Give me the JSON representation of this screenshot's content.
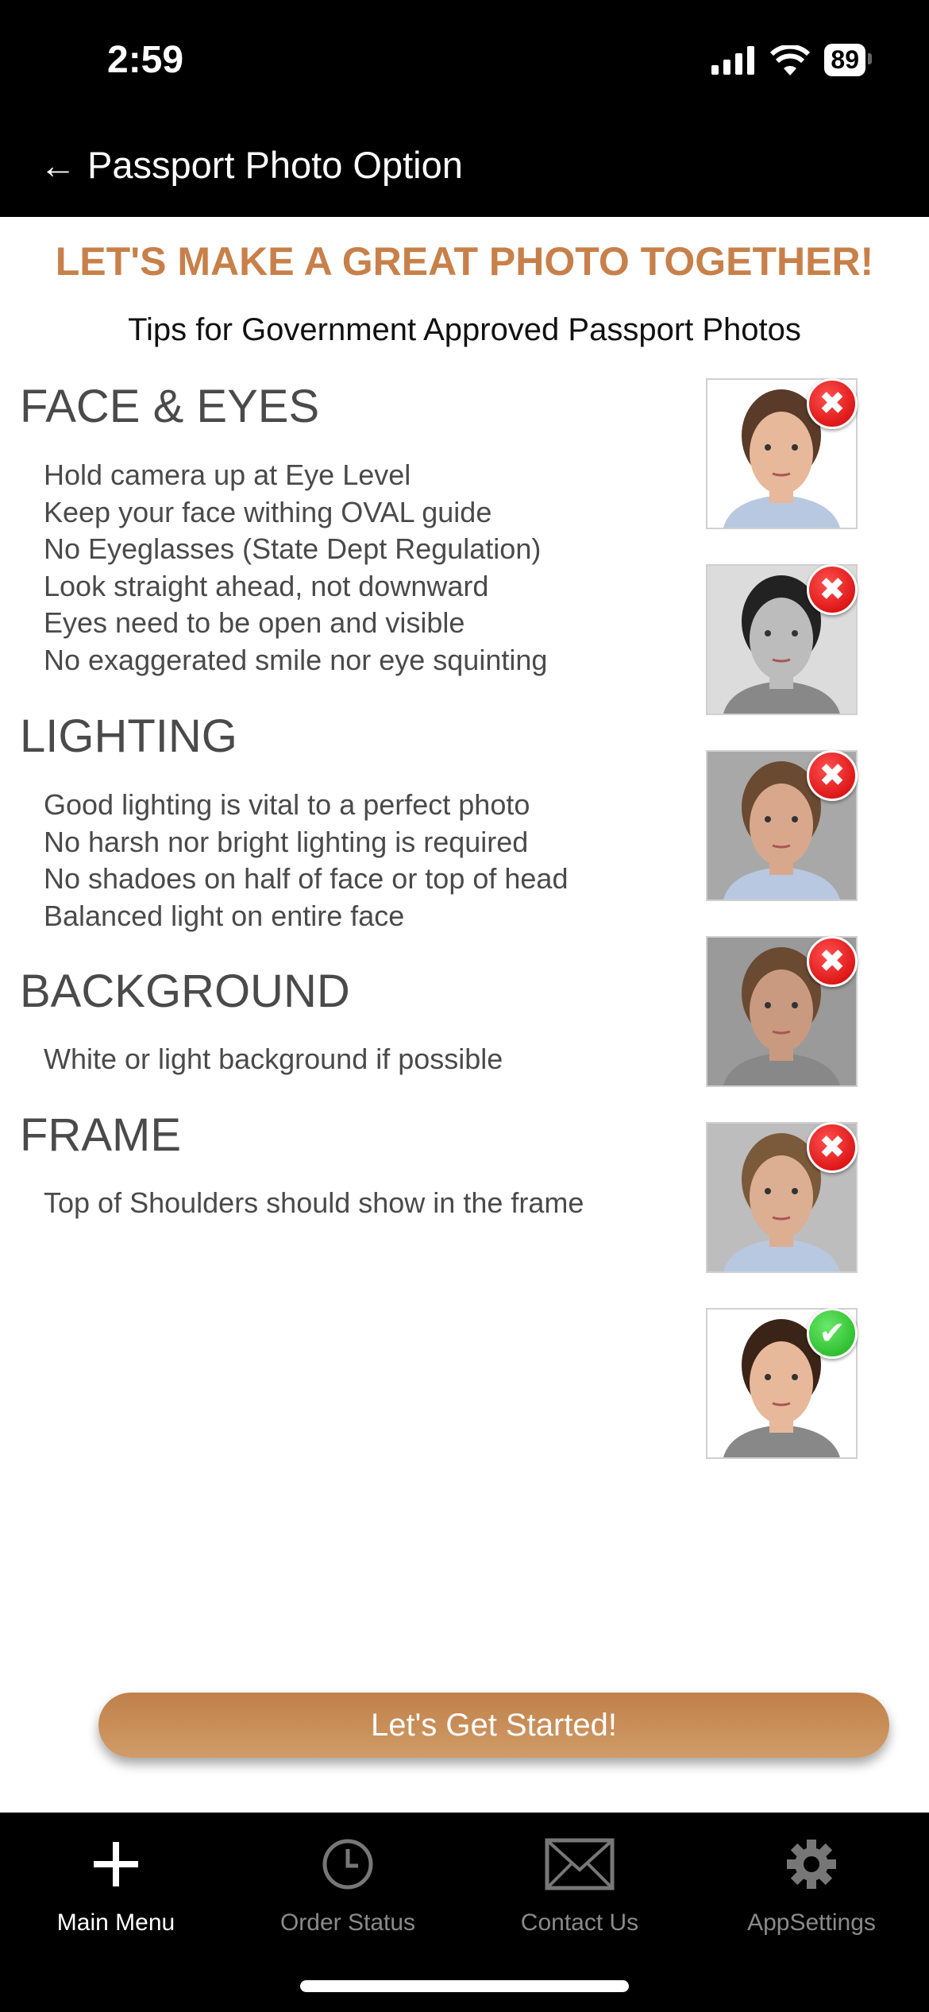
{
  "status_bar": {
    "time": "2:59",
    "battery": "89",
    "icons": [
      "cellular-signal-icon",
      "wifi-icon",
      "battery-icon"
    ]
  },
  "header": {
    "back_icon": "arrow-left-icon",
    "title": "Passport Photo Option"
  },
  "main": {
    "title": "LET'S MAKE A GREAT PHOTO TOGETHER!",
    "subtitle": "Tips for Government Approved Passport Photos",
    "sections": [
      {
        "heading": "FACE & EYES",
        "tips": [
          "Hold camera up at Eye Level",
          "Keep your face withing OVAL guide",
          "No Eyeglasses (State Dept Regulation)",
          "Look straight ahead, not downward",
          "Eyes need to be open and visible",
          "No exaggerated smile nor eye squinting"
        ]
      },
      {
        "heading": "LIGHTING",
        "tips": [
          "Good lighting is vital to a perfect photo",
          "No harsh nor bright lighting is required",
          "No shadoes on half of face or top of head",
          "Balanced light on entire face"
        ]
      },
      {
        "heading": "BACKGROUND",
        "tips": [
          "White or light background if possible"
        ]
      },
      {
        "heading": "FRAME",
        "tips": [
          "Top of Shoulders should show in the frame"
        ]
      }
    ],
    "example_photos": [
      {
        "status": "rejected",
        "badge_icon": "x-icon"
      },
      {
        "status": "rejected",
        "badge_icon": "x-icon"
      },
      {
        "status": "rejected",
        "badge_icon": "x-icon"
      },
      {
        "status": "rejected",
        "badge_icon": "x-icon"
      },
      {
        "status": "rejected",
        "badge_icon": "x-icon"
      },
      {
        "status": "approved",
        "badge_icon": "check-icon"
      }
    ],
    "cta_label": "Let's Get Started!"
  },
  "tabbar": {
    "items": [
      {
        "label": "Main Menu",
        "icon": "plus-icon",
        "active": true
      },
      {
        "label": "Order Status",
        "icon": "clock-icon",
        "active": false
      },
      {
        "label": "Contact Us",
        "icon": "envelope-icon",
        "active": false
      },
      {
        "label": "AppSettings",
        "icon": "gear-icon",
        "active": false
      }
    ]
  },
  "colors": {
    "accent": "#c8804a",
    "reject": "#e00000",
    "approve": "#22bb22"
  }
}
